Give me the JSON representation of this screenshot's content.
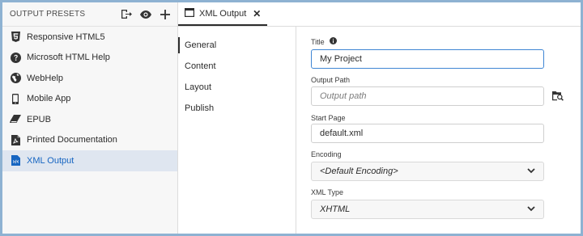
{
  "left_panel": {
    "title": "OUTPUT PRESETS",
    "header_icons": [
      "export-icon",
      "eye-icon",
      "plus-icon"
    ],
    "presets": [
      {
        "label": "Responsive HTML5",
        "icon": "html5-icon",
        "active": false
      },
      {
        "label": "Microsoft HTML Help",
        "icon": "help-circle-icon",
        "active": false
      },
      {
        "label": "WebHelp",
        "icon": "globe-icon",
        "active": false
      },
      {
        "label": "Mobile App",
        "icon": "mobile-icon",
        "active": false
      },
      {
        "label": "EPUB",
        "icon": "epub-icon",
        "active": false
      },
      {
        "label": "Printed Documentation",
        "icon": "pdf-icon",
        "active": false
      },
      {
        "label": "XML Output",
        "icon": "xml-file-icon",
        "active": true
      }
    ]
  },
  "tab": {
    "label": "XML Output",
    "icon": "window-icon",
    "close": "✕"
  },
  "subnav": [
    "General",
    "Content",
    "Layout",
    "Publish"
  ],
  "form": {
    "title": {
      "label": "Title",
      "value": "My Project",
      "info_icon": "info-icon"
    },
    "output_path": {
      "label": "Output Path",
      "placeholder": "Output path",
      "browse_icon": "browse-folder-icon"
    },
    "start_page": {
      "label": "Start Page",
      "value": "default.xml"
    },
    "encoding": {
      "label": "Encoding",
      "value": "<Default Encoding>"
    },
    "xml_type": {
      "label": "XML Type",
      "value": "XHTML"
    }
  },
  "colors": {
    "accent": "#1665c1",
    "active_row": "#dfe6f0",
    "frame": "#8eb2d2",
    "focus": "#3f86d4"
  }
}
